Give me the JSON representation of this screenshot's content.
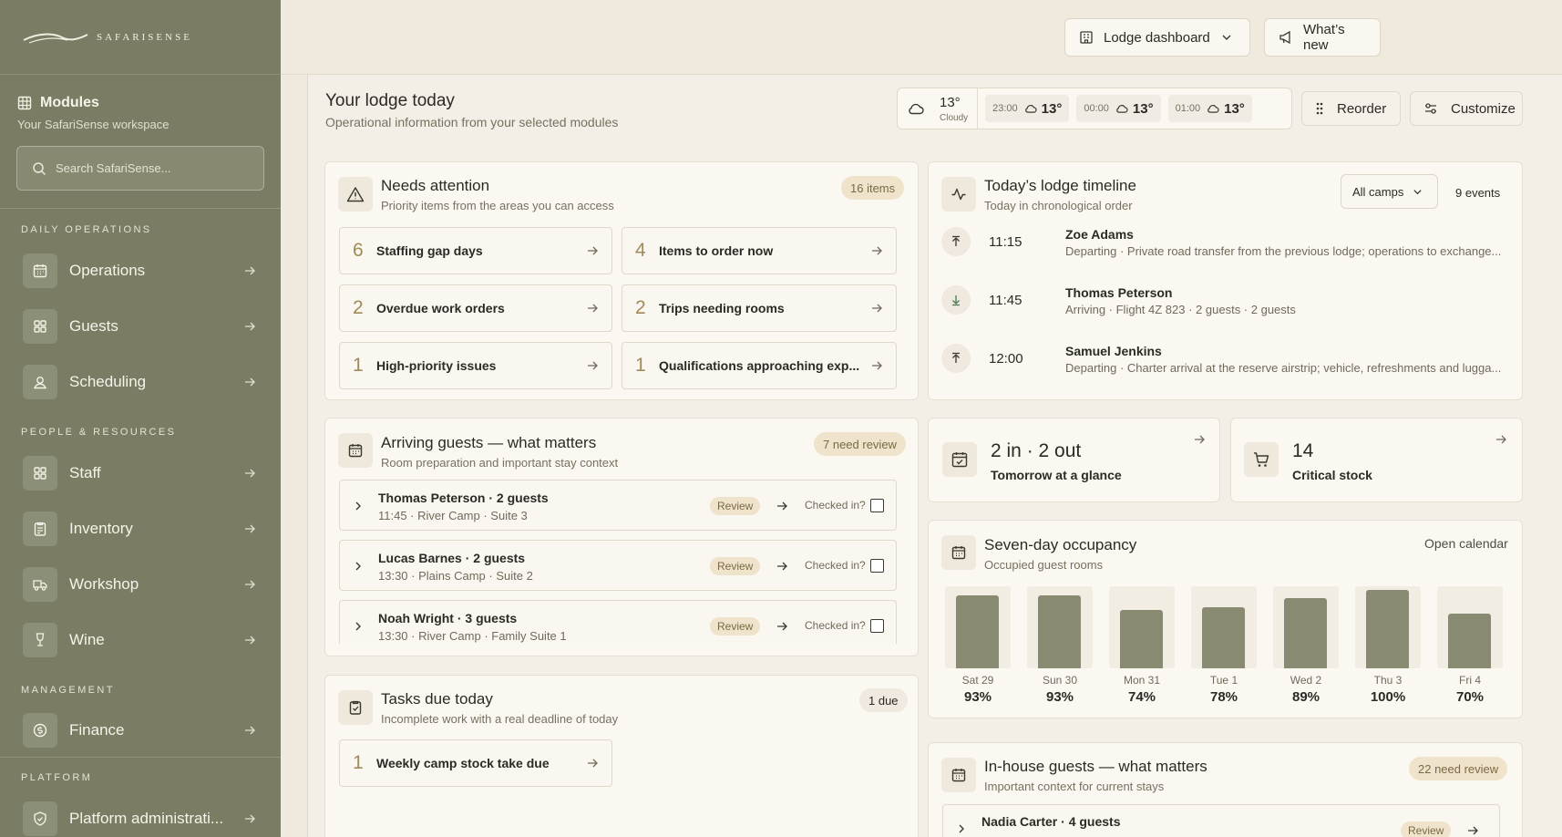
{
  "brand": {
    "name": "SAFARISENSE"
  },
  "sidebar": {
    "modules_title": "Modules",
    "modules_subtitle": "Your SafariSense workspace",
    "search_placeholder": "Search SafariSense...",
    "sections": [
      {
        "title": "DAILY OPERATIONS",
        "items": [
          {
            "label": "Operations",
            "icon": "calendar-icon"
          },
          {
            "label": "Guests",
            "icon": "grid-icon"
          },
          {
            "label": "Scheduling",
            "icon": "user-icon"
          }
        ]
      },
      {
        "title": "PEOPLE & RESOURCES",
        "items": [
          {
            "label": "Staff",
            "icon": "grid-icon"
          },
          {
            "label": "Inventory",
            "icon": "clipboard-icon"
          },
          {
            "label": "Workshop",
            "icon": "truck-icon"
          },
          {
            "label": "Wine",
            "icon": "wine-glass-icon"
          }
        ]
      },
      {
        "title": "MANAGEMENT",
        "items": [
          {
            "label": "Finance",
            "icon": "coin-icon"
          }
        ]
      },
      {
        "title": "PLATFORM",
        "items": [
          {
            "label": "Platform administrati...",
            "icon": "shield-icon"
          }
        ]
      }
    ]
  },
  "topbar": {
    "dashboard_label": "Lodge dashboard",
    "whats_new_label": "What’s new"
  },
  "page": {
    "title": "Your lodge today",
    "subtitle": "Operational information from your selected modules",
    "reorder_label": "Reorder",
    "customize_label": "Customize"
  },
  "weather": {
    "now_temp": "13°",
    "now_condition": "Cloudy",
    "forecast": [
      {
        "time": "23:00",
        "temp": "13°"
      },
      {
        "time": "00:00",
        "temp": "13°"
      },
      {
        "time": "01:00",
        "temp": "13°"
      }
    ]
  },
  "needs_attention": {
    "title": "Needs attention",
    "subtitle": "Priority items from the areas you can access",
    "badge": "16 items",
    "tiles": [
      {
        "count": "6",
        "label": "Staffing gap days"
      },
      {
        "count": "4",
        "label": "Items to order now"
      },
      {
        "count": "2",
        "label": "Overdue work orders"
      },
      {
        "count": "2",
        "label": "Trips needing rooms"
      },
      {
        "count": "1",
        "label": "High-priority issues"
      },
      {
        "count": "1",
        "label": "Qualifications approaching exp..."
      }
    ]
  },
  "timeline": {
    "title": "Today’s lodge timeline",
    "subtitle": "Today in chronological order",
    "filter": "All camps",
    "count": "9 events",
    "events": [
      {
        "time": "11:15",
        "name": "Zoe Adams",
        "detail": "Departing · Private road transfer from the previous lodge; operations to exchange...",
        "direction": "departing"
      },
      {
        "time": "11:45",
        "name": "Thomas Peterson",
        "detail": "Arriving · Flight 4Z 823 · 2 guests · 2 guests",
        "direction": "arriving"
      },
      {
        "time": "12:00",
        "name": "Samuel Jenkins",
        "detail": "Departing · Charter arrival at the reserve airstrip; vehicle, refreshments and lugga...",
        "direction": "departing"
      }
    ]
  },
  "arriving": {
    "title": "Arriving guests — what matters",
    "subtitle": "Room preparation and important stay context",
    "badge": "7 need review",
    "review_label": "Review",
    "checked_label": "Checked in?",
    "guests": [
      {
        "name": "Thomas Peterson · 2 guests",
        "detail": "11:45 · River Camp · Suite 3"
      },
      {
        "name": "Lucas Barnes · 2 guests",
        "detail": "13:30 · Plains Camp · Suite 2"
      },
      {
        "name": "Noah Wright · 3 guests",
        "detail": "13:30 · River Camp · Family Suite 1"
      }
    ]
  },
  "glance": {
    "big": "2 in · 2 out",
    "small": "Tomorrow at a glance"
  },
  "stock": {
    "big": "14",
    "small": "Critical stock"
  },
  "occupancy": {
    "title": "Seven-day occupancy",
    "subtitle": "Occupied guest rooms",
    "link": "Open calendar",
    "days": [
      {
        "day": "Sat 29",
        "pct": "93%",
        "value": 93
      },
      {
        "day": "Sun 30",
        "pct": "93%",
        "value": 93
      },
      {
        "day": "Mon 31",
        "pct": "74%",
        "value": 74
      },
      {
        "day": "Tue 1",
        "pct": "78%",
        "value": 78
      },
      {
        "day": "Wed 2",
        "pct": "89%",
        "value": 89
      },
      {
        "day": "Thu 3",
        "pct": "100%",
        "value": 100
      },
      {
        "day": "Fri 4",
        "pct": "70%",
        "value": 70
      }
    ]
  },
  "tasks": {
    "title": "Tasks due today",
    "subtitle": "Incomplete work with a real deadline of today",
    "badge": "1 due",
    "items": [
      {
        "count": "1",
        "label": "Weekly camp stock take due"
      }
    ]
  },
  "inhouse": {
    "title": "In-house guests — what matters",
    "subtitle": "Important context for current stays",
    "badge": "22 need review",
    "guests": [
      {
        "name": "Nadia Carter · 4 guests"
      }
    ],
    "review_label": "Review"
  },
  "colors": {
    "sidebar": "#7a7d63",
    "accent_gold": "#a08a57",
    "bar": "#888a72",
    "background": "#efe9de"
  }
}
